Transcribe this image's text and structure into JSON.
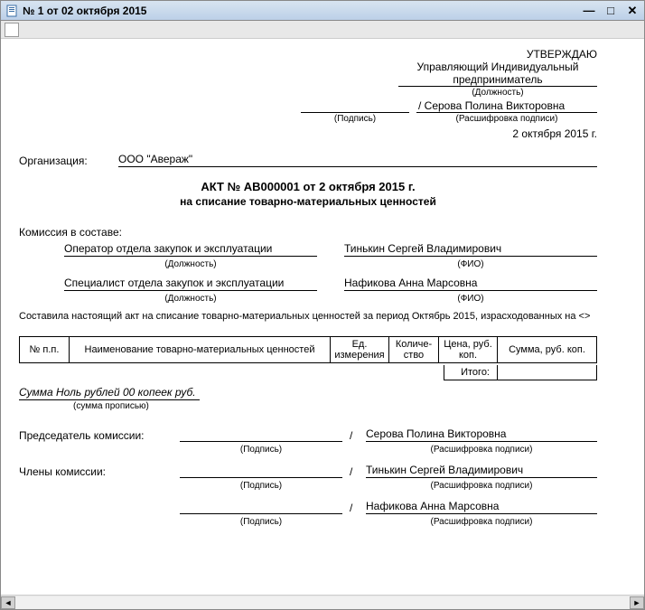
{
  "window": {
    "title": "№ 1 от 02 октября 2015"
  },
  "approve": {
    "heading": "УТВЕРЖДАЮ",
    "position": "Управляющий Индивидуальный предприниматель",
    "position_caption": "(Должность)",
    "name": "/ Серова Полина Викторовна",
    "sig_caption": "(Подпись)",
    "name_caption": "(Расшифровка подписи)",
    "date": "2 октября 2015 г."
  },
  "org": {
    "label": "Организация:",
    "value": "ООО \"Авераж\""
  },
  "title": "АКТ № АВ000001 от 2 октября 2015 г.",
  "subtitle": "на списание товарно-материальных ценностей",
  "commission": {
    "label": "Комиссия в составе:",
    "role_caption": "(Должность)",
    "name_caption": "(ФИО)",
    "members": [
      {
        "role": "Оператор отдела закупок и эксплуатации",
        "name": "Тинькин Сергей Владимирович"
      },
      {
        "role": "Специалист отдела закупок и эксплуатации",
        "name": "Нафикова Анна Марсовна"
      }
    ]
  },
  "description": "Составила настоящий акт на списание товарно-материальных ценностей за период Октябрь 2015, израсходованных на <>",
  "table": {
    "headers": [
      "№ п.п.",
      "Наименование товарно-материальных ценностей",
      "Ед. измерения",
      "Количе-ство",
      "Цена, руб. коп.",
      "Сумма, руб. коп."
    ],
    "total_label": "Итого:",
    "total_value": ""
  },
  "sum_words": {
    "value": "Сумма Ноль рублей 00 копеек руб.",
    "caption": "(сумма прописью)"
  },
  "signatures": {
    "chairman_label": "Председатель комиссии:",
    "members_label": "Члены комиссии:",
    "sig_caption": "(Подпись)",
    "name_caption": "(Расшифровка подписи)",
    "rows": [
      {
        "name": "Серова Полина Викторовна"
      },
      {
        "name": "Тинькин Сергей Владимирович"
      },
      {
        "name": "Нафикова Анна Марсовна"
      }
    ]
  }
}
